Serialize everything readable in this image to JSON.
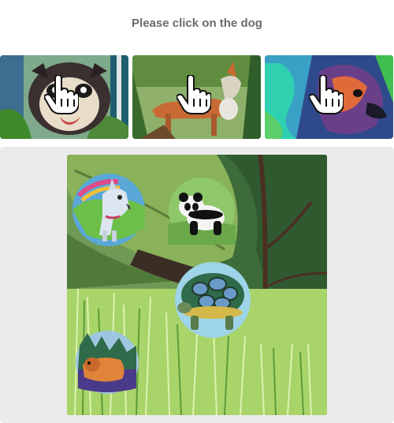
{
  "prompt": "Please click on the dog",
  "examples": [
    {
      "icon": "hand-pointer-cursor"
    },
    {
      "icon": "hand-pointer-cursor"
    },
    {
      "icon": "hand-pointer-cursor"
    }
  ],
  "scene": {
    "objects": [
      "dog",
      "panda",
      "turtle",
      "bear"
    ]
  }
}
